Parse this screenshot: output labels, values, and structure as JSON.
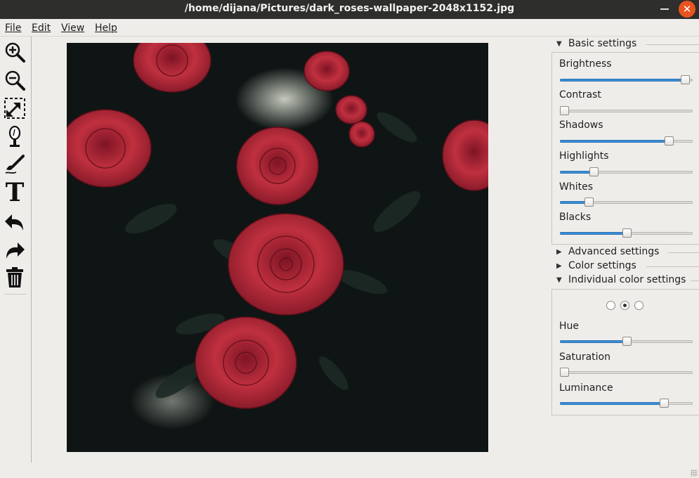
{
  "window": {
    "title": "/home/dijana/Pictures/dark_roses-wallpaper-2048x1152.jpg",
    "close_glyph": "✕",
    "accent_color": "#e95420"
  },
  "menubar": {
    "items": [
      {
        "mnemonic": "F",
        "rest": "ile"
      },
      {
        "mnemonic": "E",
        "rest": "dit"
      },
      {
        "mnemonic": "V",
        "rest": "iew"
      },
      {
        "mnemonic": "H",
        "rest": "elp"
      }
    ]
  },
  "toolbar": {
    "tools": [
      "zoom-in-icon",
      "zoom-out-icon",
      "fit-to-window-icon",
      "color-picker-icon",
      "brush-icon",
      "text-tool-icon",
      "undo-icon",
      "redo-icon",
      "delete-icon"
    ],
    "text_glyph": "T"
  },
  "panel": {
    "basic": {
      "title": "Basic settings",
      "expanded": true,
      "sliders": [
        {
          "label": "Brightness",
          "value": 0.97
        },
        {
          "label": "Contrast",
          "value": 0.0
        },
        {
          "label": "Shadows",
          "value": 0.84
        },
        {
          "label": "Highlights",
          "value": 0.24
        },
        {
          "label": "Whites",
          "value": 0.2
        },
        {
          "label": "Blacks",
          "value": 0.5
        }
      ]
    },
    "advanced": {
      "title": "Advanced settings",
      "expanded": false
    },
    "color": {
      "title": "Color settings",
      "expanded": false
    },
    "individual": {
      "title": "Individual color settings",
      "expanded": true,
      "radio_selected": 1,
      "sliders": [
        {
          "label": "Hue",
          "value": 0.5
        },
        {
          "label": "Saturation",
          "value": 0.0
        },
        {
          "label": "Luminance",
          "value": 0.8
        }
      ]
    },
    "glyph_expanded": "▼",
    "glyph_collapsed": "▶"
  },
  "colors": {
    "slider_fill": "#3b8ed8",
    "canvas_bg": "#0e1514",
    "rose": "#b3263a"
  }
}
